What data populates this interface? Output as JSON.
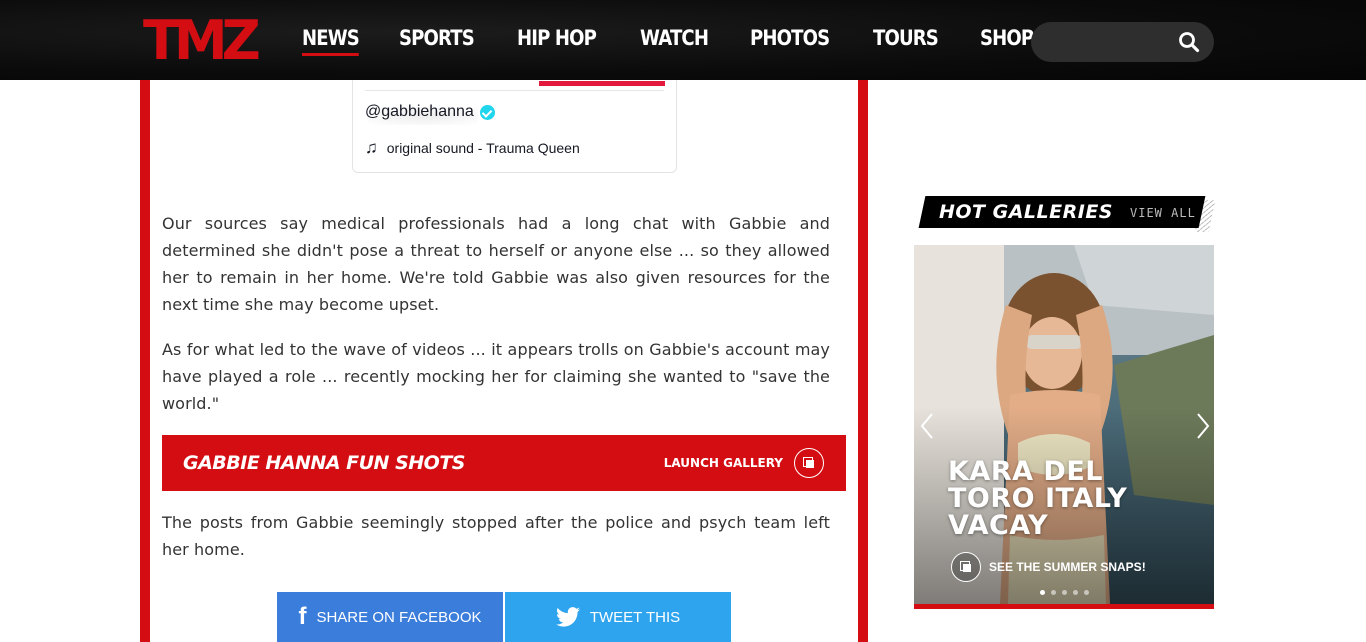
{
  "header": {
    "logo_text": "TMZ",
    "nav": [
      {
        "label": "NEWS",
        "active": true
      },
      {
        "label": "SPORTS",
        "active": false
      },
      {
        "label": "HIP HOP",
        "active": false
      },
      {
        "label": "WATCH",
        "active": false
      },
      {
        "label": "PHOTOS",
        "active": false
      },
      {
        "label": "TOURS",
        "active": false
      },
      {
        "label": "SHOP",
        "active": false
      }
    ],
    "search": {
      "placeholder": "",
      "value": "",
      "icon": "search-icon"
    }
  },
  "tiktok_embed": {
    "handle": "@gabbiehanna",
    "verified": true,
    "sound": "original sound - Trauma Queen",
    "accent_color": "#e2183c"
  },
  "article": {
    "paragraphs": [
      "Our sources say medical professionals had a long chat with Gabbie and determined she didn't pose a threat to herself or anyone else ... so they allowed her to remain in her home. We're told Gabbie was also given resources for the next time she may become upset.",
      "As for what led to the wave of videos ... it appears trolls on Gabbie's account may have played a role ... recently mocking her for claiming she wanted to \"save the world.\"",
      "The posts from Gabbie seemingly stopped after the police and psych team left her home."
    ],
    "gallery_banner": {
      "title": "GABBIE HANNA FUN SHOTS",
      "launch_label": "LAUNCH GALLERY",
      "icon": "gallery-stack-icon"
    },
    "share": {
      "facebook_label": "SHARE ON FACEBOOK",
      "twitter_label": "TWEET THIS"
    }
  },
  "sidebar": {
    "hot_galleries": {
      "title": "HOT GALLERIES",
      "view_all": "VIEW ALL",
      "slide": {
        "title": "KARA DEL TORO ITALY VACAY",
        "cta": "SEE THE SUMMER SNAPS!"
      },
      "dots_count": 5,
      "active_dot": 0
    }
  },
  "colors": {
    "brand_red": "#d40d12",
    "header_bg": "#0b0b0b",
    "facebook_blue": "#3b7ddb",
    "twitter_blue": "#2ea4ee"
  }
}
